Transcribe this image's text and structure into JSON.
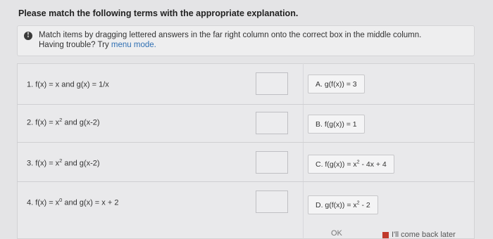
{
  "prompt": "Please match the following terms with the appropriate explanation.",
  "info": {
    "icon": "info-icon",
    "text": "Match items by dragging lettered answers in the far right column onto the correct box in the middle column.",
    "help_text": "Having trouble? Try",
    "help_link": "menu mode."
  },
  "terms": [
    {
      "num": "1.",
      "pre": "f(x) = x and g(x) = 1/x",
      "sup": "",
      "post": ""
    },
    {
      "num": "2.",
      "pre": "f(x) = x",
      "sup": "2",
      "post": " and g(x-2)"
    },
    {
      "num": "3.",
      "pre": "f(x) = x",
      "sup": "2",
      "post": " and g(x-2)"
    },
    {
      "num": "4.",
      "pre": "f(x) = x",
      "sup": "0",
      "post": " and g(x) = x + 2"
    }
  ],
  "answers": [
    {
      "pre": "A. g(f(x)) = 3",
      "sup": "",
      "post": ""
    },
    {
      "pre": "B. f(g(x)) = 1",
      "sup": "",
      "post": ""
    },
    {
      "pre": "C. f(g(x)) = x",
      "sup": "2",
      "post": " - 4x + 4"
    },
    {
      "pre": "D. g(f(x)) = x",
      "sup": "2",
      "post": " - 2"
    }
  ],
  "footer": {
    "ok_partial": "OK",
    "later_label": "I'll come back later"
  }
}
